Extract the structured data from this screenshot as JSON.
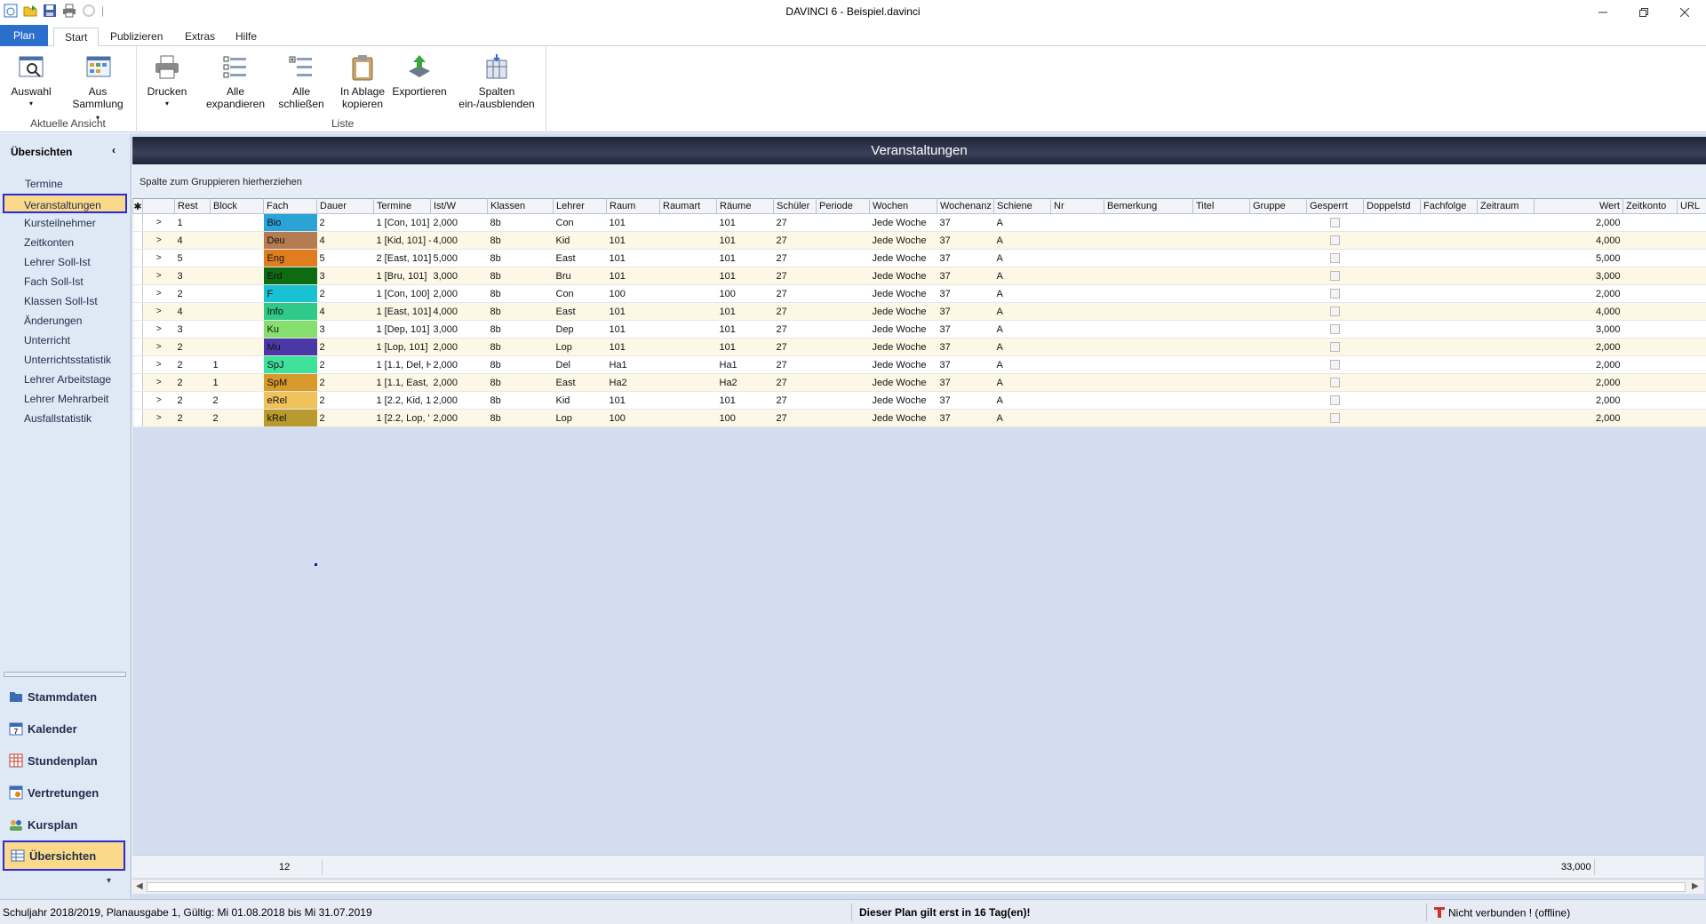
{
  "window": {
    "title": "DAVINCI 6 - Beispiel.davinci"
  },
  "ribbon_tabs": {
    "plan": "Plan",
    "start": "Start",
    "publizieren": "Publizieren",
    "extras": "Extras",
    "hilfe": "Hilfe"
  },
  "ribbon": {
    "auswahl": "Auswahl",
    "aus_sammlung_1": "Aus",
    "aus_sammlung_2": "Sammlung",
    "group_aktuelle_ansicht": "Aktuelle Ansicht",
    "drucken": "Drucken",
    "alle_expandieren_1": "Alle",
    "alle_expandieren_2": "expandieren",
    "alle_schliessen_1": "Alle",
    "alle_schliessen_2": "schließen",
    "in_ablage_1": "In Ablage",
    "in_ablage_2": "kopieren",
    "exportieren": "Exportieren",
    "spalten_1": "Spalten",
    "spalten_2": "ein-/ausblenden",
    "group_liste": "Liste"
  },
  "sidebar": {
    "title": "Übersichten",
    "collapse_glyph": "‹",
    "items": [
      "Termine",
      "Veranstaltungen",
      "Kursteilnehmer",
      "Zeitkonten",
      "Lehrer Soll-Ist",
      "Fach Soll-Ist",
      "Klassen Soll-Ist",
      "Änderungen",
      "Unterricht",
      "Unterrichtsstatistik",
      "Lehrer Arbeitstage",
      "Lehrer Mehrarbeit",
      "Ausfallstatistik"
    ],
    "selected_item": "Veranstaltungen",
    "big_nav": {
      "stammdaten": "Stammdaten",
      "kalender": "Kalender",
      "stundenplan": "Stundenplan",
      "vertretungen": "Vertretungen",
      "kursplan": "Kursplan",
      "uebersichten": "Übersichten"
    }
  },
  "main": {
    "header": "Veranstaltungen",
    "group_hint": "Spalte zum Gruppieren hierherziehen",
    "columns": {
      "rest": "Rest",
      "block": "Block",
      "fach": "Fach",
      "dauer": "Dauer",
      "termine": "Termine",
      "istw": "Ist/W",
      "klassen": "Klassen",
      "lehrer": "Lehrer",
      "raum": "Raum",
      "raumart": "Raumart",
      "raeume": "Räume",
      "schueler": "Schüler",
      "periode": "Periode",
      "wochen": "Wochen",
      "wochenanz": "Wochenanz",
      "schiene": "Schiene",
      "nr": "Nr",
      "bemerkung": "Bemerkung",
      "titel": "Titel",
      "gruppe": "Gruppe",
      "gesperrt": "Gesperrt",
      "doppelstd": "Doppelstd",
      "fachfolge": "Fachfolge",
      "zeitraum": "Zeitraum",
      "wert": "Wert",
      "zeitkonto": "Zeitkonto",
      "url": "URL"
    },
    "rows": [
      {
        "rest": "1",
        "block": "",
        "fach": "Bio",
        "fach_color": "#2aa3d6",
        "dauer": "2",
        "termine": "1 [Con, 101]",
        "istw": "2,000",
        "klassen": "8b",
        "lehrer": "Con",
        "raum": "101",
        "raeume": "101",
        "schueler": "27",
        "wochen": "Jede Woche",
        "wochenanz": "37",
        "schiene": "A",
        "wert": "2,000"
      },
      {
        "rest": "4",
        "block": "",
        "fach": "Deu",
        "fach_color": "#b57b52",
        "dauer": "4",
        "termine": "1 [Kid, 101] -",
        "istw": "4,000",
        "klassen": "8b",
        "lehrer": "Kid",
        "raum": "101",
        "raeume": "101",
        "schueler": "27",
        "wochen": "Jede Woche",
        "wochenanz": "37",
        "schiene": "A",
        "wert": "4,000"
      },
      {
        "rest": "5",
        "block": "",
        "fach": "Eng",
        "fach_color": "#e07d1c",
        "dauer": "5",
        "termine": "2 [East, 101]",
        "istw": "5,000",
        "klassen": "8b",
        "lehrer": "East",
        "raum": "101",
        "raeume": "101",
        "schueler": "27",
        "wochen": "Jede Woche",
        "wochenanz": "37",
        "schiene": "A",
        "wert": "5,000"
      },
      {
        "rest": "3",
        "block": "",
        "fach": "Erd",
        "fach_color": "#0d6b12",
        "dauer": "3",
        "termine": "1 [Bru, 101]",
        "istw": "3,000",
        "klassen": "8b",
        "lehrer": "Bru",
        "raum": "101",
        "raeume": "101",
        "schueler": "27",
        "wochen": "Jede Woche",
        "wochenanz": "37",
        "schiene": "A",
        "wert": "3,000"
      },
      {
        "rest": "2",
        "block": "",
        "fach": "F",
        "fach_color": "#18c2d2",
        "dauer": "2",
        "termine": "1 [Con, 100]",
        "istw": "2,000",
        "klassen": "8b",
        "lehrer": "Con",
        "raum": "100",
        "raeume": "100",
        "schueler": "27",
        "wochen": "Jede Woche",
        "wochenanz": "37",
        "schiene": "A",
        "wert": "2,000"
      },
      {
        "rest": "4",
        "block": "",
        "fach": "Info",
        "fach_color": "#2fc98a",
        "dauer": "4",
        "termine": "1 [East, 101]",
        "istw": "4,000",
        "klassen": "8b",
        "lehrer": "East",
        "raum": "101",
        "raeume": "101",
        "schueler": "27",
        "wochen": "Jede Woche",
        "wochenanz": "37",
        "schiene": "A",
        "wert": "4,000"
      },
      {
        "rest": "3",
        "block": "",
        "fach": "Ku",
        "fach_color": "#86de6e",
        "dauer": "3",
        "termine": "1 [Dep, 101]",
        "istw": "3,000",
        "klassen": "8b",
        "lehrer": "Dep",
        "raum": "101",
        "raeume": "101",
        "schueler": "27",
        "wochen": "Jede Woche",
        "wochenanz": "37",
        "schiene": "A",
        "wert": "3,000"
      },
      {
        "rest": "2",
        "block": "",
        "fach": "Mu",
        "fach_color": "#4a38a6",
        "dauer": "2",
        "termine": "1 [Lop, 101]",
        "istw": "2,000",
        "klassen": "8b",
        "lehrer": "Lop",
        "raum": "101",
        "raeume": "101",
        "schueler": "27",
        "wochen": "Jede Woche",
        "wochenanz": "37",
        "schiene": "A",
        "wert": "2,000"
      },
      {
        "rest": "2",
        "block": "1",
        "fach": "SpJ",
        "fach_color": "#3ee29b",
        "dauer": "2",
        "termine": "1 [1.1, Del, H",
        "istw": "2,000",
        "klassen": "8b",
        "lehrer": "Del",
        "raum": "Ha1",
        "raeume": "Ha1",
        "schueler": "27",
        "wochen": "Jede Woche",
        "wochenanz": "37",
        "schiene": "A",
        "wert": "2,000"
      },
      {
        "rest": "2",
        "block": "1",
        "fach": "SpM",
        "fach_color": "#d89a2c",
        "dauer": "2",
        "termine": "1 [1.1, East,",
        "istw": "2,000",
        "klassen": "8b",
        "lehrer": "East",
        "raum": "Ha2",
        "raeume": "Ha2",
        "schueler": "27",
        "wochen": "Jede Woche",
        "wochenanz": "37",
        "schiene": "A",
        "wert": "2,000"
      },
      {
        "rest": "2",
        "block": "2",
        "fach": "eRel",
        "fach_color": "#efc25c",
        "dauer": "2",
        "termine": "1 [2.2, Kid, 1",
        "istw": "2,000",
        "klassen": "8b",
        "lehrer": "Kid",
        "raum": "101",
        "raeume": "101",
        "schueler": "27",
        "wochen": "Jede Woche",
        "wochenanz": "37",
        "schiene": "A",
        "wert": "2,000"
      },
      {
        "rest": "2",
        "block": "2",
        "fach": "kRel",
        "fach_color": "#b99a2e",
        "dauer": "2",
        "termine": "1 [2.2, Lop, '",
        "istw": "2,000",
        "klassen": "8b",
        "lehrer": "Lop",
        "raum": "100",
        "raeume": "100",
        "schueler": "27",
        "wochen": "Jede Woche",
        "wochenanz": "37",
        "schiene": "A",
        "wert": "2,000"
      }
    ],
    "footer_count": "12",
    "footer_total": "33,000"
  },
  "statusbar": {
    "left": "Schuljahr 2018/2019, Planausgabe 1, Gültig: Mi 01.08.2018 bis Mi 31.07.2019",
    "center": "Dieser Plan gilt erst in 16 Tag(en)!",
    "right": "Nicht verbunden ! (offline)"
  },
  "colors": {
    "accent_blue": "#2b6fcd",
    "selection_fill": "#fbd98a",
    "selection_border": "#2a2adf",
    "header_dark": "#1f2438"
  }
}
